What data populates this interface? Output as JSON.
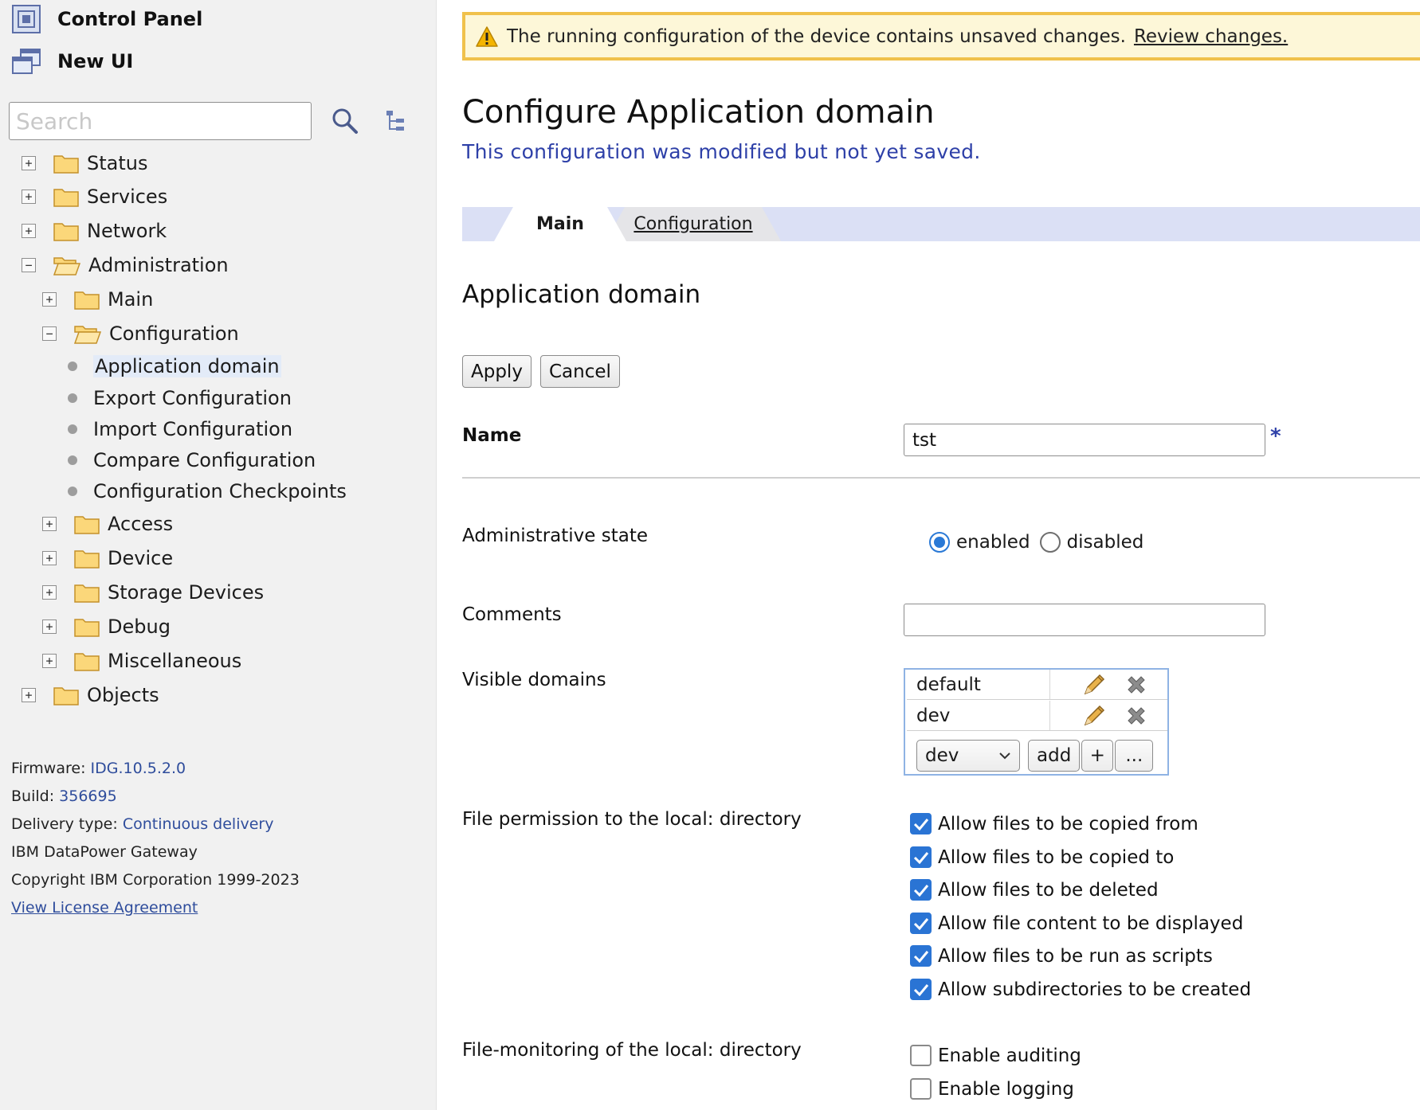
{
  "sidebar": {
    "control_panel_label": "Control Panel",
    "new_ui_label": "New UI",
    "search_placeholder": "Search",
    "tree": {
      "status": "Status",
      "services": "Services",
      "network": "Network",
      "administration": "Administration",
      "main": "Main",
      "configuration": "Configuration",
      "application_domain": "Application domain",
      "export_configuration": "Export Configuration",
      "import_configuration": "Import Configuration",
      "compare_configuration": "Compare Configuration",
      "configuration_checkpoints": "Configuration Checkpoints",
      "access": "Access",
      "device": "Device",
      "storage_devices": "Storage Devices",
      "debug": "Debug",
      "miscellaneous": "Miscellaneous",
      "objects": "Objects"
    },
    "toggle_collapsed": "+",
    "toggle_expanded": "−",
    "footer": {
      "firmware_label": "Firmware:",
      "firmware_value": "IDG.10.5.2.0",
      "build_label": "Build:",
      "build_value": "356695",
      "delivery_label": "Delivery type:",
      "delivery_value": "Continuous delivery",
      "product": "IBM DataPower Gateway",
      "copyright": "Copyright IBM Corporation 1999-2023",
      "license_link": "View License Agreement"
    }
  },
  "banner": {
    "message": "The running configuration of the device contains unsaved changes.",
    "link": "Review changes."
  },
  "page": {
    "title": "Configure Application domain",
    "modified_note": "This configuration was modified but not yet saved.",
    "tabs": {
      "main": "Main",
      "configuration": "Configuration"
    },
    "section_title": "Application domain",
    "apply_label": "Apply",
    "cancel_label": "Cancel"
  },
  "form": {
    "name_label": "Name",
    "name_value": "tst",
    "required_marker": "*",
    "admin_state_label": "Administrative state",
    "admin_state_options": {
      "enabled": "enabled",
      "disabled": "disabled"
    },
    "admin_state_selected": "enabled",
    "comments_label": "Comments",
    "comments_value": "",
    "visible_domains_label": "Visible domains",
    "visible_domains": [
      "default",
      "dev"
    ],
    "domain_select_value": "dev",
    "add_label": "add",
    "plus_label": "+",
    "more_label": "...",
    "file_permission_label": "File permission to the local: directory",
    "file_permissions": {
      "copied_from": "Allow files to be copied from",
      "copied_to": "Allow files to be copied to",
      "deleted": "Allow files to be deleted",
      "displayed": "Allow file content to be displayed",
      "run_as_scripts": "Allow files to be run as scripts",
      "subdirectories": "Allow subdirectories to be created"
    },
    "file_monitoring_label": "File-monitoring of the local: directory",
    "file_monitoring": {
      "auditing": "Enable auditing",
      "logging": "Enable logging"
    }
  },
  "colors": {
    "accent_blue": "#2e40a8",
    "checkbox_blue": "#2a74d4",
    "banner_border": "#f0c14b",
    "banner_bg": "#fdf7d8",
    "tabbar_bg": "#dbe0f5",
    "sidebar_bg": "#f1f1f1"
  },
  "icons": {
    "control_panel": "control-panel-icon",
    "new_ui": "new-window-icon",
    "search": "search-icon",
    "tree_view": "tree-view-icon",
    "folder": "folder-icon",
    "folder_open": "folder-open-icon",
    "warning": "warning-icon",
    "edit": "pencil-icon",
    "delete": "delete-x-icon",
    "dropdown": "chevron-down-icon",
    "check": "checkmark-icon"
  }
}
